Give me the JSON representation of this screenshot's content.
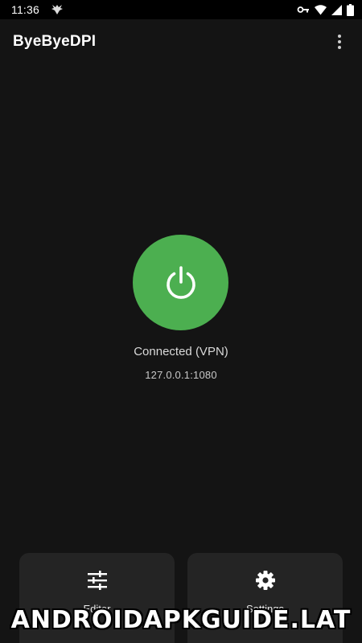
{
  "status_bar": {
    "time": "11:36",
    "icons": [
      "notification-icon",
      "vpn-key-icon",
      "wifi-icon",
      "cellular-signal-icon",
      "battery-icon"
    ]
  },
  "app_bar": {
    "title": "ByeByeDPI",
    "overflow_icon": "more-vert-icon"
  },
  "main": {
    "connect_button_icon": "power-icon",
    "accent_color": "#4caf50",
    "status_text": "Connected (VPN)",
    "address_text": "127.0.0.1:1080"
  },
  "cards": {
    "editor": {
      "label": "Editor",
      "icon": "tune-icon"
    },
    "settings": {
      "label": "Settings",
      "icon": "gear-icon"
    }
  },
  "watermark": {
    "text": "ANDROIDAPKGUIDE.LAT"
  }
}
